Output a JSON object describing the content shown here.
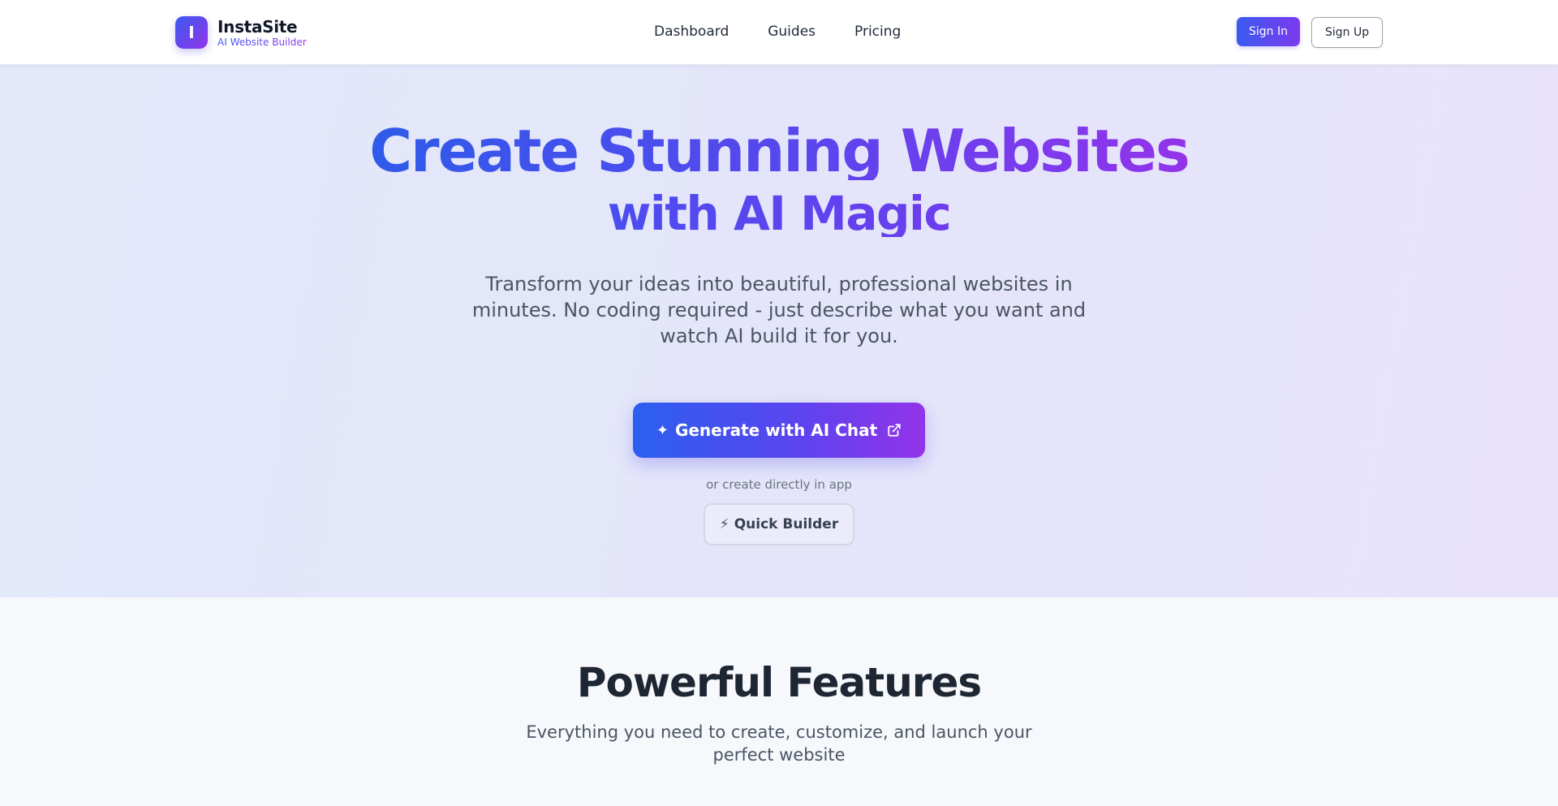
{
  "header": {
    "brand": {
      "logo_letter": "I",
      "name": "InstaSite",
      "tagline": "AI Website Builder"
    },
    "nav": [
      {
        "label": "Dashboard"
      },
      {
        "label": "Guides"
      },
      {
        "label": "Pricing"
      }
    ],
    "sign_in_label": "Sign In",
    "sign_up_label": "Sign Up"
  },
  "hero": {
    "title_line1": "Create Stunning Websites",
    "title_line2": "with AI Magic",
    "subtitle": "Transform your ideas into beautiful, professional websites in minutes. No coding required - just describe what you want and watch AI build it for you.",
    "generate_button": {
      "icon": "sparkle-icon",
      "label": "Generate with AI Chat",
      "trailing_icon": "external-link-icon"
    },
    "or_text": "or create directly in app",
    "quick_builder_button": {
      "icon": "bolt-icon",
      "label": "Quick Builder"
    }
  },
  "features": {
    "title": "Powerful Features",
    "subtitle": "Everything you need to create, customize, and launch your perfect website"
  },
  "colors": {
    "accent_blue": "#3b5bf0",
    "accent_purple": "#9333ea",
    "hero_bg": "#e4e5fa",
    "page_bg": "#f6f8fc"
  }
}
